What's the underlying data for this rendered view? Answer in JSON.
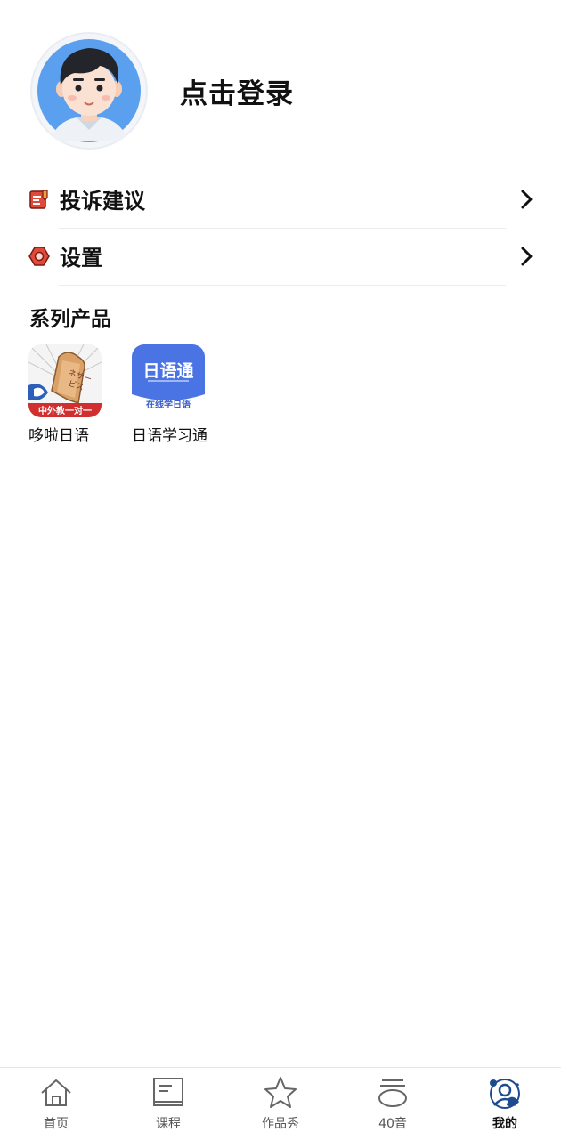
{
  "profile": {
    "login_text": "点击登录",
    "avatar_icon": "user-avatar-icon"
  },
  "menu": [
    {
      "label": "投诉建议",
      "icon": "feedback-icon",
      "accent": "#e04a3a"
    },
    {
      "label": "设置",
      "icon": "settings-icon",
      "accent": "#e04a3a"
    }
  ],
  "products": {
    "title": "系列产品",
    "items": [
      {
        "name": "哆啦日语",
        "badge": "中外教一对一",
        "icon_text": "ネサービス哆啦"
      },
      {
        "name": "日语学习通",
        "icon_title": "日语通",
        "icon_subtitle": "在线学日语"
      }
    ]
  },
  "tabbar": {
    "active_color": "#1e4b8f",
    "tabs": [
      {
        "label": "首页",
        "icon": "home-icon",
        "active": false
      },
      {
        "label": "课程",
        "icon": "course-icon",
        "active": false
      },
      {
        "label": "作品秀",
        "icon": "star-icon",
        "active": false
      },
      {
        "label": "40音",
        "icon": "kana-icon",
        "active": false
      },
      {
        "label": "我的",
        "icon": "profile-icon",
        "active": true
      }
    ]
  }
}
